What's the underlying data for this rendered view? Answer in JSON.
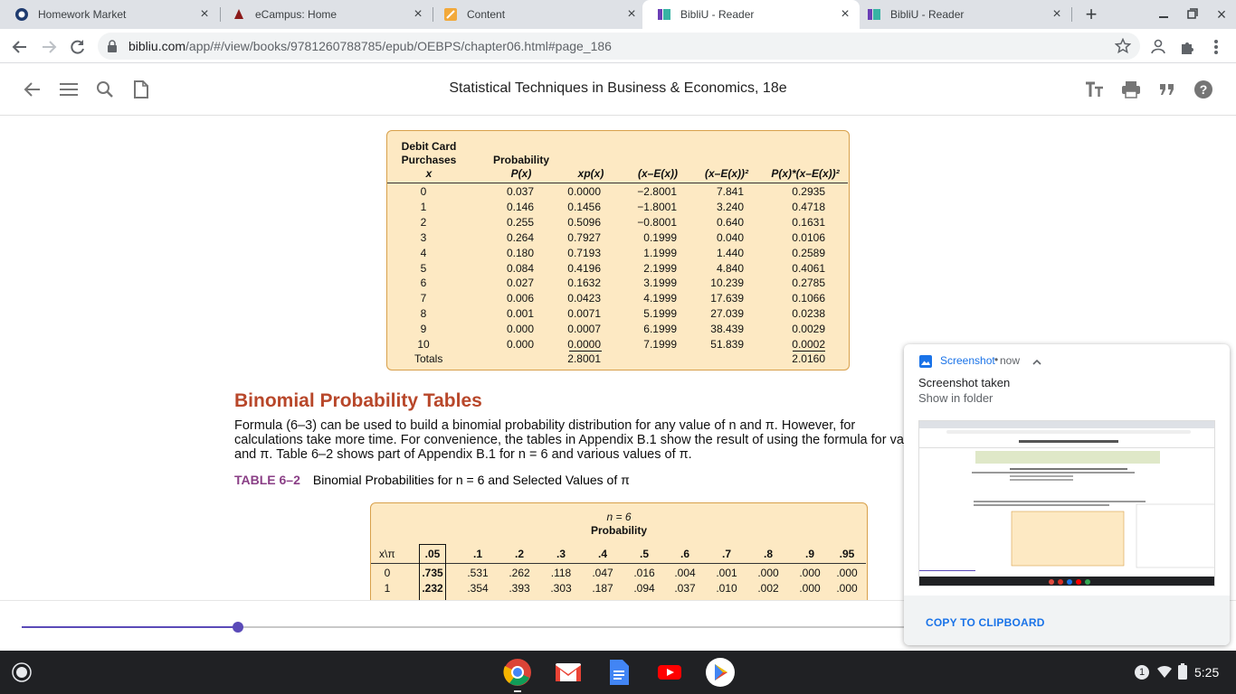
{
  "browser": {
    "tabs": [
      {
        "title": "Homework Market",
        "active": false
      },
      {
        "title": "eCampus: Home",
        "active": false
      },
      {
        "title": "Content",
        "active": false
      },
      {
        "title": "BibliU - Reader",
        "active": true
      },
      {
        "title": "BibliU - Reader",
        "active": false
      }
    ],
    "url_host": "bibliu.com",
    "url_path": "/app/#/view/books/9781260788785/epub/OEBPS/chapter06.html#page_186"
  },
  "reader": {
    "book_title": "Statistical Techniques in Business & Economics, 18e",
    "progress_fraction": 0.245
  },
  "table1": {
    "headers": {
      "x_line1": "Debit Card",
      "x_line2": "Purchases",
      "x_line3": "x",
      "p_line1": "Probability",
      "p_line2": "P(x)",
      "xp": "xp(x)",
      "dev": "(x–E(x))",
      "dev2": "(x–E(x))²",
      "pdev2": "P(x)*(x–E(x))²"
    },
    "rows": [
      [
        "0",
        "0.037",
        "0.0000",
        "−2.8001",
        "7.841",
        "0.2935"
      ],
      [
        "1",
        "0.146",
        "0.1456",
        "−1.8001",
        "3.240",
        "0.4718"
      ],
      [
        "2",
        "0.255",
        "0.5096",
        "−0.8001",
        "0.640",
        "0.1631"
      ],
      [
        "3",
        "0.264",
        "0.7927",
        "0.1999",
        "0.040",
        "0.0106"
      ],
      [
        "4",
        "0.180",
        "0.7193",
        "1.1999",
        "1.440",
        "0.2589"
      ],
      [
        "5",
        "0.084",
        "0.4196",
        "2.1999",
        "4.840",
        "0.4061"
      ],
      [
        "6",
        "0.027",
        "0.1632",
        "3.1999",
        "10.239",
        "0.2785"
      ],
      [
        "7",
        "0.006",
        "0.0423",
        "4.1999",
        "17.639",
        "0.1066"
      ],
      [
        "8",
        "0.001",
        "0.0071",
        "5.1999",
        "27.039",
        "0.0238"
      ],
      [
        "9",
        "0.000",
        "0.0007",
        "6.1999",
        "38.439",
        "0.0029"
      ],
      [
        "10",
        "0.000",
        "0.0000",
        "7.1999",
        "51.839",
        "0.0002"
      ]
    ],
    "totals": {
      "label": "Totals",
      "xp": "2.8001",
      "pdev2": "2.0160"
    }
  },
  "section": {
    "title": "Binomial Probability Tables",
    "para_lines": [
      "Formula (6–3) can be used to build a binomial probability distribution for any value of n and π. However, for",
      "calculations take more time. For convenience, the tables in Appendix B.1 show the result of using the formula for va",
      "and π. Table 6–2 shows part of Appendix B.1 for n = 6 and various values of π."
    ],
    "table_label_num": "TABLE 6–2",
    "table_label_text": "Binomial Probabilities for n = 6 and Selected Values of π"
  },
  "table2": {
    "title_line1": "n = 6",
    "title_line2": "Probability",
    "corner": "x\\π",
    "cols": [
      ".05",
      ".1",
      ".2",
      ".3",
      ".4",
      ".5",
      ".6",
      ".7",
      ".8",
      ".9",
      ".95"
    ],
    "rows": [
      [
        "0",
        ".735",
        ".531",
        ".262",
        ".118",
        ".047",
        ".016",
        ".004",
        ".001",
        ".000",
        ".000",
        ".000"
      ],
      [
        "1",
        ".232",
        ".354",
        ".393",
        ".303",
        ".187",
        ".094",
        ".037",
        ".010",
        ".002",
        ".000",
        ".000"
      ]
    ]
  },
  "notification": {
    "app": "Screenshot",
    "time": "now",
    "title": "Screenshot taken",
    "subtitle": "Show in folder",
    "action": "COPY TO CLIPBOARD"
  },
  "shelf": {
    "apps": [
      "chrome-icon",
      "gmail-icon",
      "docs-icon",
      "youtube-icon",
      "play-store-icon"
    ],
    "notification_count": "1",
    "time": "5:25"
  }
}
